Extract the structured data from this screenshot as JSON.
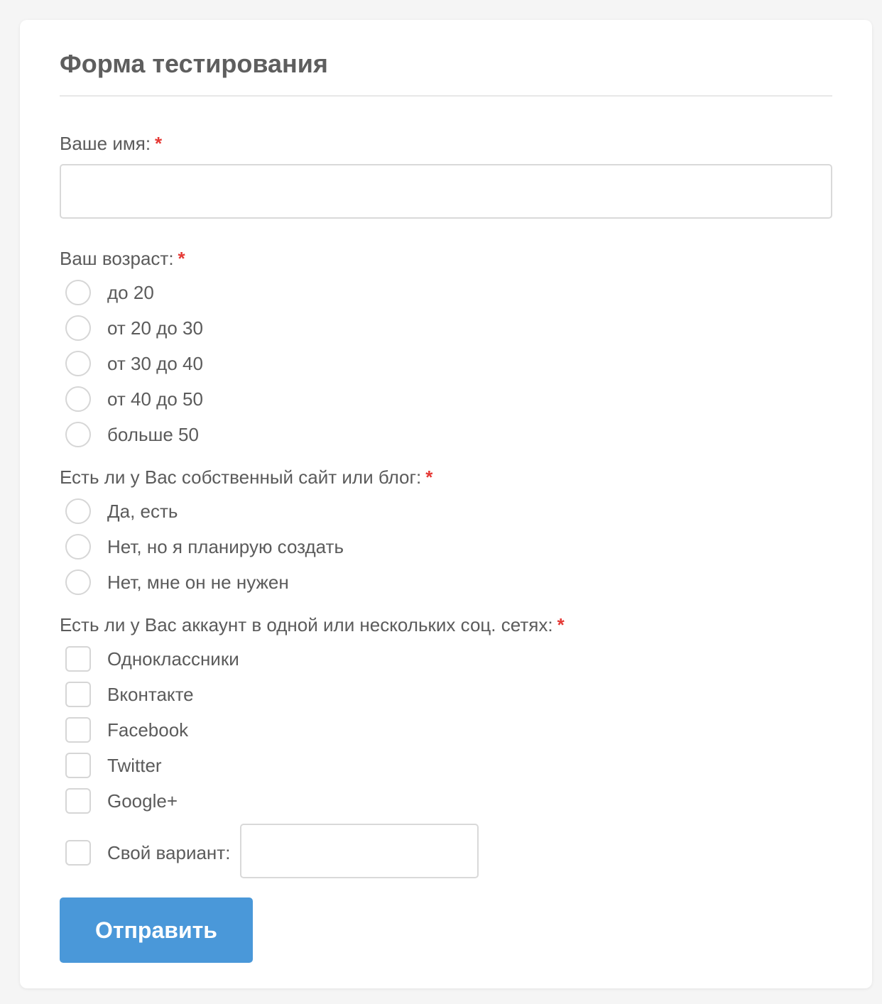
{
  "form": {
    "title": "Форма тестирования",
    "required_marker": "*",
    "name": {
      "label": "Ваше имя:",
      "value": "",
      "placeholder": ""
    },
    "age": {
      "label": "Ваш возраст:",
      "options": [
        "до 20",
        "от 20 до 30",
        "от 30 до 40",
        "от 40 до 50",
        "больше 50"
      ]
    },
    "site": {
      "label": "Есть ли у Вас собственный сайт или блог:",
      "options": [
        "Да, есть",
        "Нет, но я планирую создать",
        "Нет, мне он не нужен"
      ]
    },
    "social": {
      "label": "Есть ли у Вас аккаунт в одной или нескольких соц. сетях:",
      "options": [
        "Одноклассники",
        "Вконтакте",
        "Facebook",
        "Twitter",
        "Google+"
      ],
      "other_label": "Свой вариант:",
      "other_value": ""
    },
    "submit_label": "Отправить"
  },
  "colors": {
    "accent": "#4a98d9",
    "required": "#e53935",
    "text": "#5b5b5b"
  }
}
